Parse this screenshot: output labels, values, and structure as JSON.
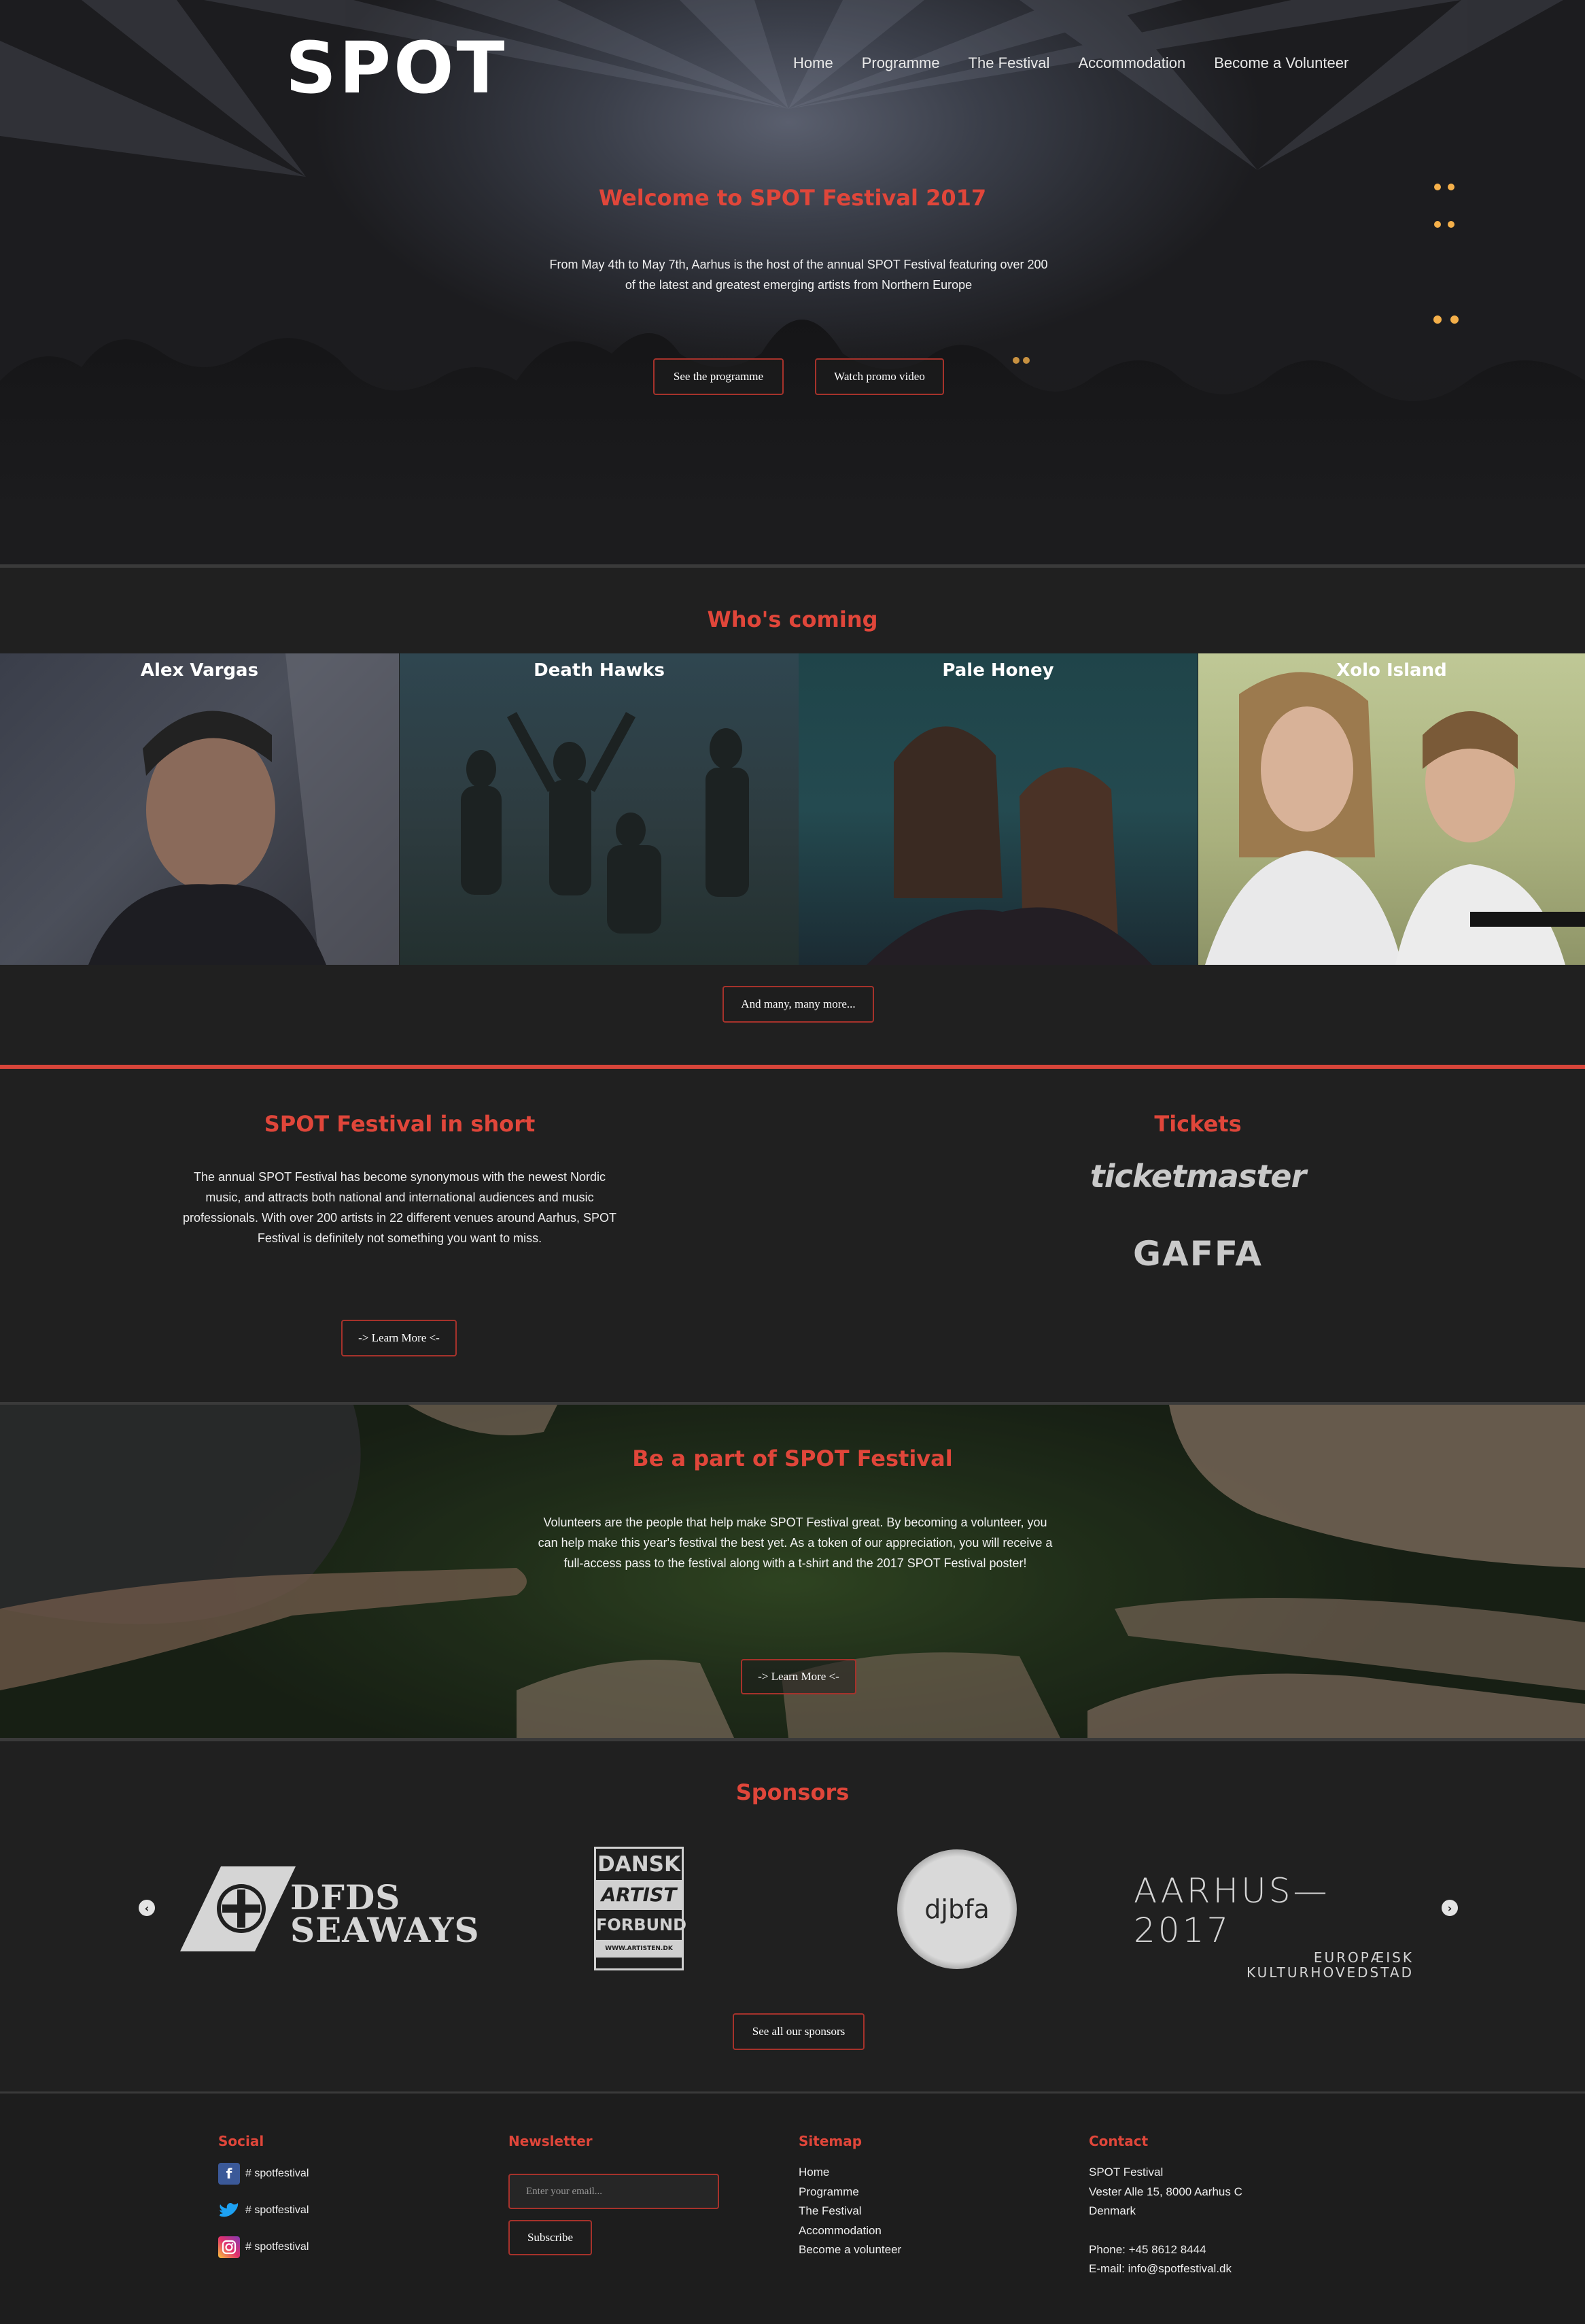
{
  "brand": {
    "logo_text": "SPOT",
    "accent_color": "#e0463a"
  },
  "nav": {
    "items": [
      "Home",
      "Programme",
      "The Festival",
      "Accommodation",
      "Become a Volunteer"
    ]
  },
  "hero": {
    "title": "Welcome to SPOT Festival 2017",
    "text": "From May 4th to May 7th, Aarhus is the host of the annual SPOT Festival featuring over 200 of the latest and greatest emerging artists from Northern Europe",
    "btn_programme": "See the programme",
    "btn_video": "Watch promo video"
  },
  "who": {
    "title": "Who's coming",
    "artists": [
      "Alex Vargas",
      "Death Hawks",
      "Pale Honey",
      "Xolo Island"
    ],
    "more_button": "And many, many more..."
  },
  "short": {
    "title": "SPOT Festival in short",
    "text": "The annual SPOT Festival has become synonymous with the newest Nordic music, and attracts both national and international audiences and music professionals. With over 200 artists in 22 different venues around Aarhus, SPOT Festival is definitely not something you want to miss.",
    "button": "-> Learn More <-"
  },
  "tickets": {
    "title": "Tickets",
    "logo1": "ticketmaster",
    "logo2": "GAFFA"
  },
  "volunteer": {
    "title": "Be a part of SPOT Festival",
    "text": "Volunteers are the people that help make SPOT Festival great. By becoming a volunteer, you can help make this year's festival the best yet. As a token of our appreciation, you will receive a full-access pass to the festival along with a t-shirt and the 2017 SPOT Festival poster!",
    "button": "-> Learn More <-"
  },
  "sponsors": {
    "title": "Sponsors",
    "dfds_line1": "DFDS",
    "dfds_line2": "SEAWAYS",
    "dansk_lines": [
      "DANSK",
      "ARTIST",
      "FORBUND",
      "WWW.ARTISTEN.DK"
    ],
    "djbfa": "djbfa",
    "aarhus_main": "AARHUS—2017",
    "aarhus_sub1": "EUROPÆISK",
    "aarhus_sub2": "KULTURHOVEDSTAD",
    "button": "See all our sponsors",
    "prev_icon": "chevron-left-icon",
    "next_icon": "chevron-right-icon"
  },
  "footer": {
    "social": {
      "title": "Social",
      "facebook": "# spotfestival",
      "twitter": "# spotfestival",
      "instagram": "# spotfestival"
    },
    "newsletter": {
      "title": "Newsletter",
      "placeholder": "Enter your email...",
      "subscribe": "Subscribe"
    },
    "sitemap": {
      "title": "Sitemap",
      "items": [
        "Home",
        "Programme",
        "The Festival",
        "Accommodation",
        "Become a volunteer"
      ]
    },
    "contact": {
      "title": "Contact",
      "name": "SPOT Festival",
      "address": "Vester Alle 15, 8000 Aarhus C",
      "country": "Denmark",
      "phone": "Phone: +45 8612 8444",
      "email": "E-mail: info@spotfestival.dk"
    }
  }
}
